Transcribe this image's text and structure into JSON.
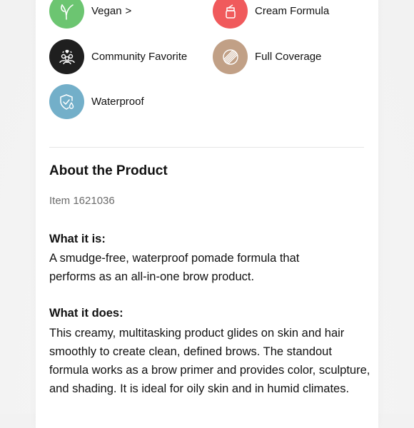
{
  "badges": [
    {
      "label": "Vegan",
      "chevron": ">",
      "icon": "leaf-icon",
      "color": "#6cc571"
    },
    {
      "label": "Cream Formula",
      "icon": "jar-icon",
      "color": "#f05a5c"
    },
    {
      "label": "Community Favorite",
      "icon": "community-icon",
      "color": "#1f1f1f"
    },
    {
      "label": "Full Coverage",
      "icon": "coverage-icon",
      "color": "#c1a086"
    },
    {
      "label": "Waterproof",
      "icon": "shield-drop-icon",
      "color": "#73afc9"
    }
  ],
  "about": {
    "title": "About the Product",
    "item_number": "Item 1621036",
    "what_it_is_title": "What it is:",
    "what_it_is_text": "A smudge-free, waterproof pomade formula that performs as an all-in-one brow product.",
    "what_it_does_title": "What it does:",
    "what_it_does_text": "This creamy, multitasking product glides on skin and hair smoothly to create clean, defined brows. The standout formula works as a brow primer and provides color, sculpture, and shading. It is ideal for oily skin and in humid climates."
  }
}
